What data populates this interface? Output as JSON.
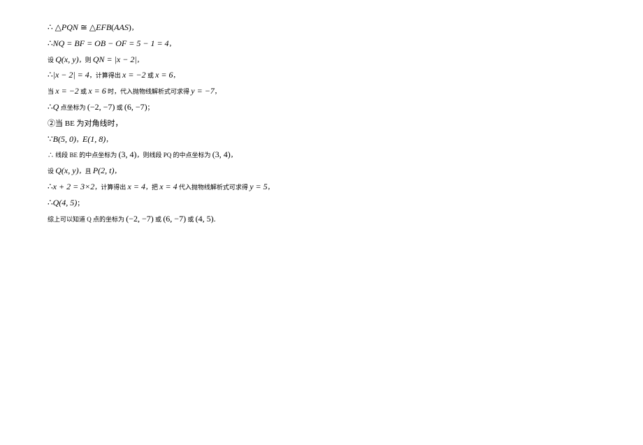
{
  "lines": {
    "l1_a": "∴ △",
    "l1_b": "PQN",
    "l1_c": " ≅ △",
    "l1_d": "EFB",
    "l1_e": "(",
    "l1_f": "AAS",
    "l1_g": ")",
    "l1_h": "，",
    "l2_a": "∴",
    "l2_b": "NQ = BF = OB − OF = 5 − 1 = 4",
    "l2_c": "，",
    "l3_a": "设 ",
    "l3_b": "Q(x, y)",
    "l3_c": "，则 ",
    "l3_d": "QN = |x − 2|",
    "l3_e": "，",
    "l4_a": "∴",
    "l4_b": "|x − 2| = 4",
    "l4_c": "，计算得出 ",
    "l4_d": "x = −2",
    "l4_e": " 或 ",
    "l4_f": "x = 6",
    "l4_g": "，",
    "l5_a": "当 ",
    "l5_b": "x = −2",
    "l5_c": " 或 ",
    "l5_d": "x = 6",
    "l5_e": " 时，代入抛物线解析式可求得 ",
    "l5_f": "y = −7",
    "l5_g": "，",
    "l6_a": "∴",
    "l6_b": "Q",
    "l6_c": " 点坐标为 ",
    "l6_d": "(−2, −7)",
    "l6_e": " 或 ",
    "l6_f": "(6, −7)",
    "l6_g": "；",
    "l7_a": "②当 BE 为对角线时，",
    "l8_a": "∵",
    "l8_b": "B(5, 0)",
    "l8_c": "，",
    "l8_d": "E(1, 8)",
    "l8_e": "，",
    "l9_a": "∴ 线段 BE 的中点坐标为 ",
    "l9_b": "(3, 4)",
    "l9_c": "，则线段 PQ 的中点坐标为 ",
    "l9_d": "(3, 4)",
    "l9_e": "，",
    "l10_a": "设 ",
    "l10_b": "Q(x, y)",
    "l10_c": "，且 ",
    "l10_d": "P(2, t)",
    "l10_e": "，",
    "l11_a": "∴",
    "l11_b": "x + 2 = 3×2",
    "l11_c": "，计算得出 ",
    "l11_d": "x = 4",
    "l11_e": "，把 ",
    "l11_f": "x = 4",
    "l11_g": " 代入抛物线解析式可求得 ",
    "l11_h": "y = 5",
    "l11_i": "，",
    "l12_a": "∴",
    "l12_b": "Q(4, 5)",
    "l12_c": "；",
    "l13_a": "综上可以知道 Q 点的坐标为 ",
    "l13_b": "(−2, −7)",
    "l13_c": " 或 ",
    "l13_d": "(6, −7)",
    "l13_e": " 或 ",
    "l13_f": "(4, 5)."
  }
}
